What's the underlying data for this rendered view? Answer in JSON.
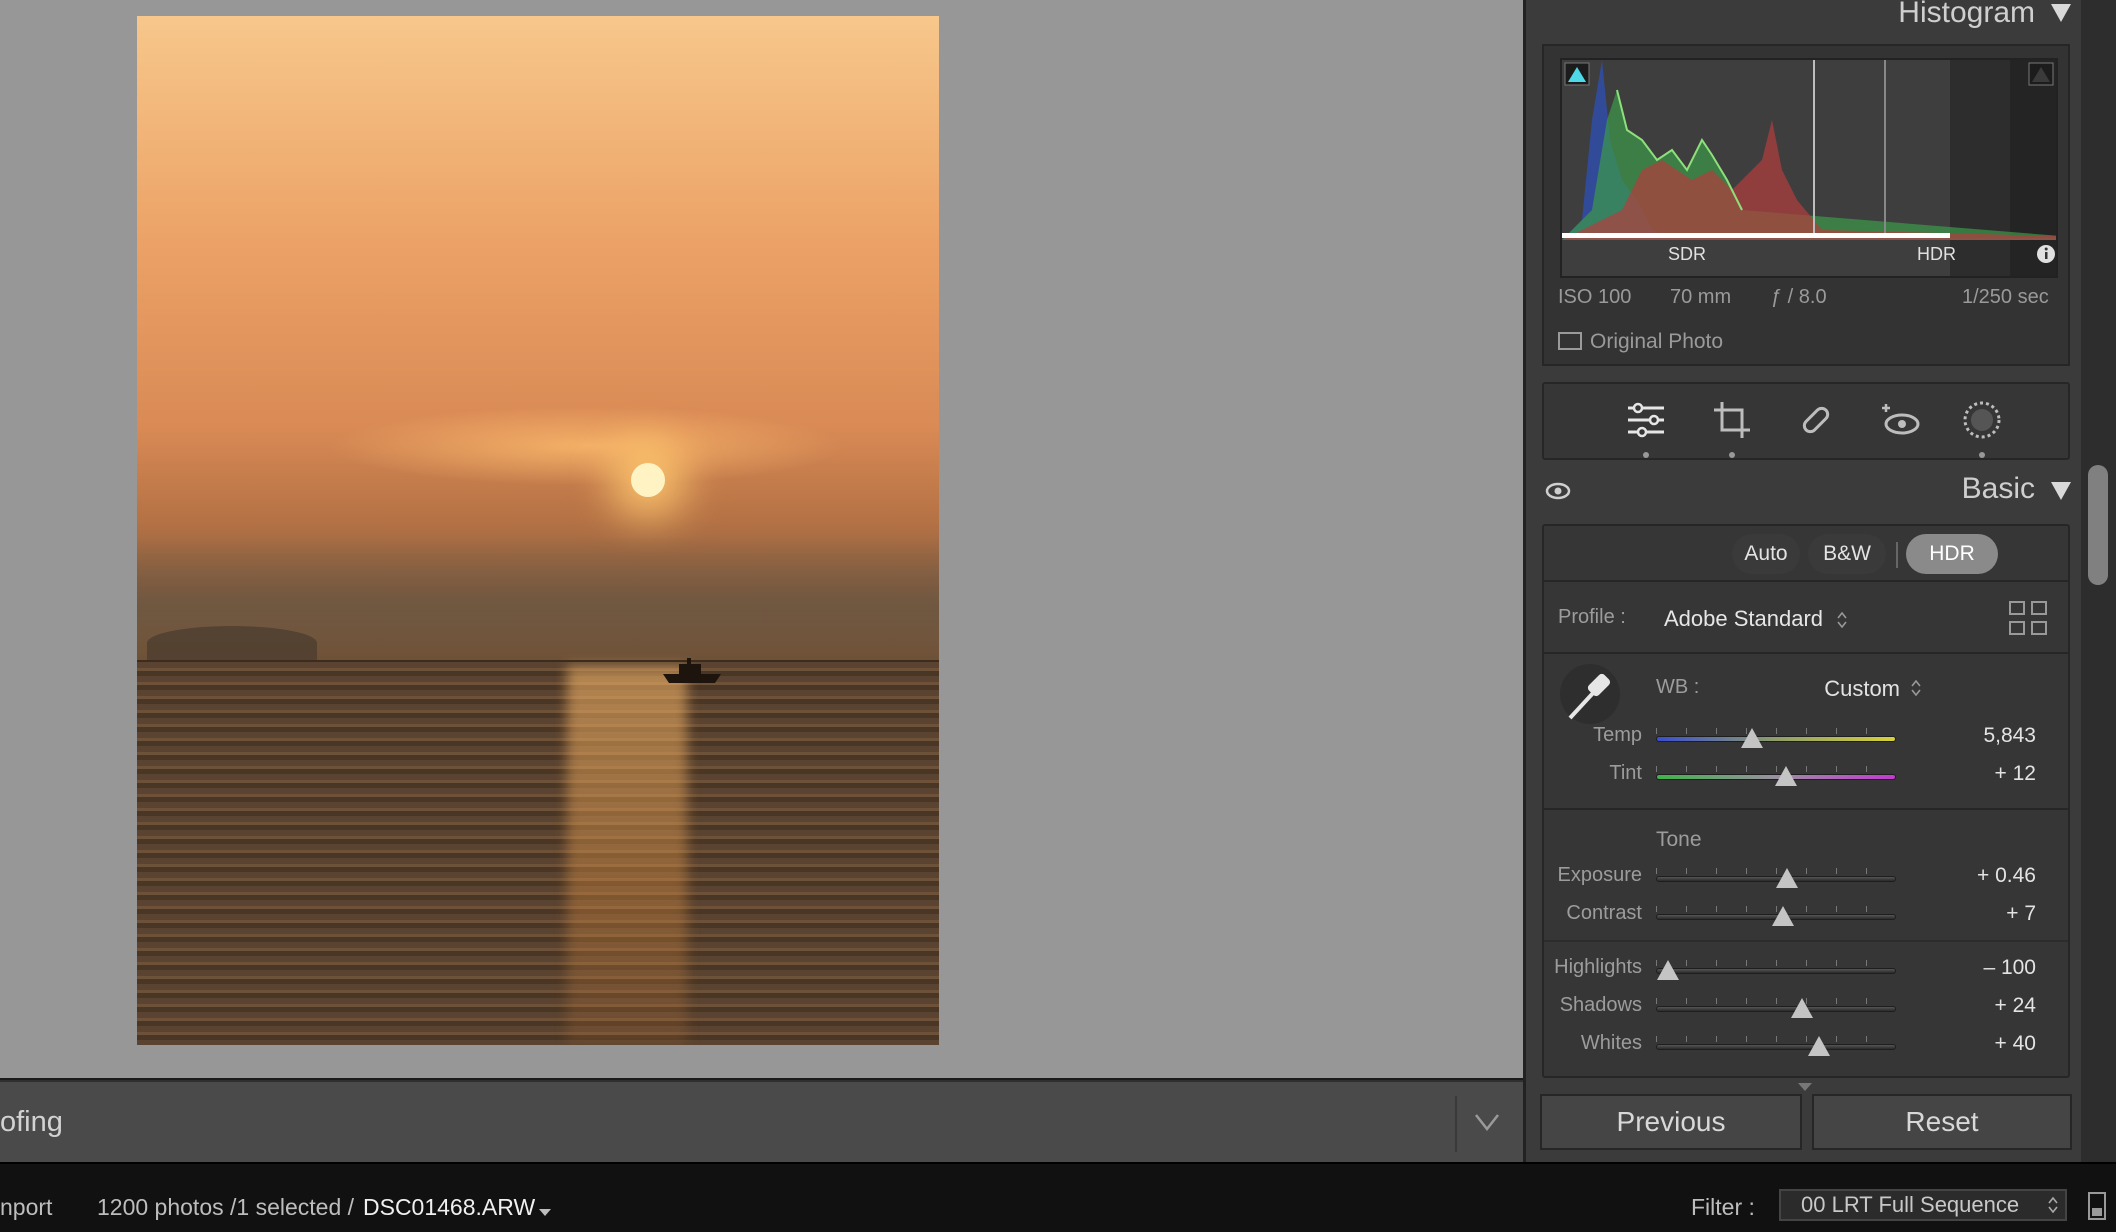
{
  "toolbar": {
    "module_label": "ofing"
  },
  "histogram": {
    "title": "Histogram",
    "sdr_label": "SDR",
    "hdr_label": "HDR",
    "iso": "ISO 100",
    "focal": "70 mm",
    "aperture": "ƒ / 8.0",
    "shutter": "1/250 sec",
    "original_photo": "Original Photo"
  },
  "basic": {
    "title": "Basic",
    "auto": "Auto",
    "bw": "B&W",
    "hdr": "HDR",
    "profile_label": "Profile :",
    "profile_value": "Adobe Standard",
    "wb_label": "WB :",
    "wb_value": "Custom",
    "tone_label": "Tone",
    "sliders": [
      {
        "label": "Temp",
        "value": "5,843",
        "pos": 0.4
      },
      {
        "label": "Tint",
        "value": "+ 12",
        "pos": 0.54
      },
      {
        "label": "Exposure",
        "value": "+ 0.46",
        "pos": 0.545
      },
      {
        "label": "Contrast",
        "value": "+ 7",
        "pos": 0.53
      },
      {
        "label": "Highlights",
        "value": "– 100",
        "pos": 0.05
      },
      {
        "label": "Shadows",
        "value": "+ 24",
        "pos": 0.61
      },
      {
        "label": "Whites",
        "value": "+ 40",
        "pos": 0.68
      }
    ]
  },
  "buttons": {
    "previous": "Previous",
    "reset": "Reset"
  },
  "status": {
    "import": "nport",
    "count": "1200 photos /1 selected /",
    "filename": "DSC01468.ARW",
    "filter_label": "Filter :",
    "filter_value": "00 LRT Full Sequence"
  }
}
